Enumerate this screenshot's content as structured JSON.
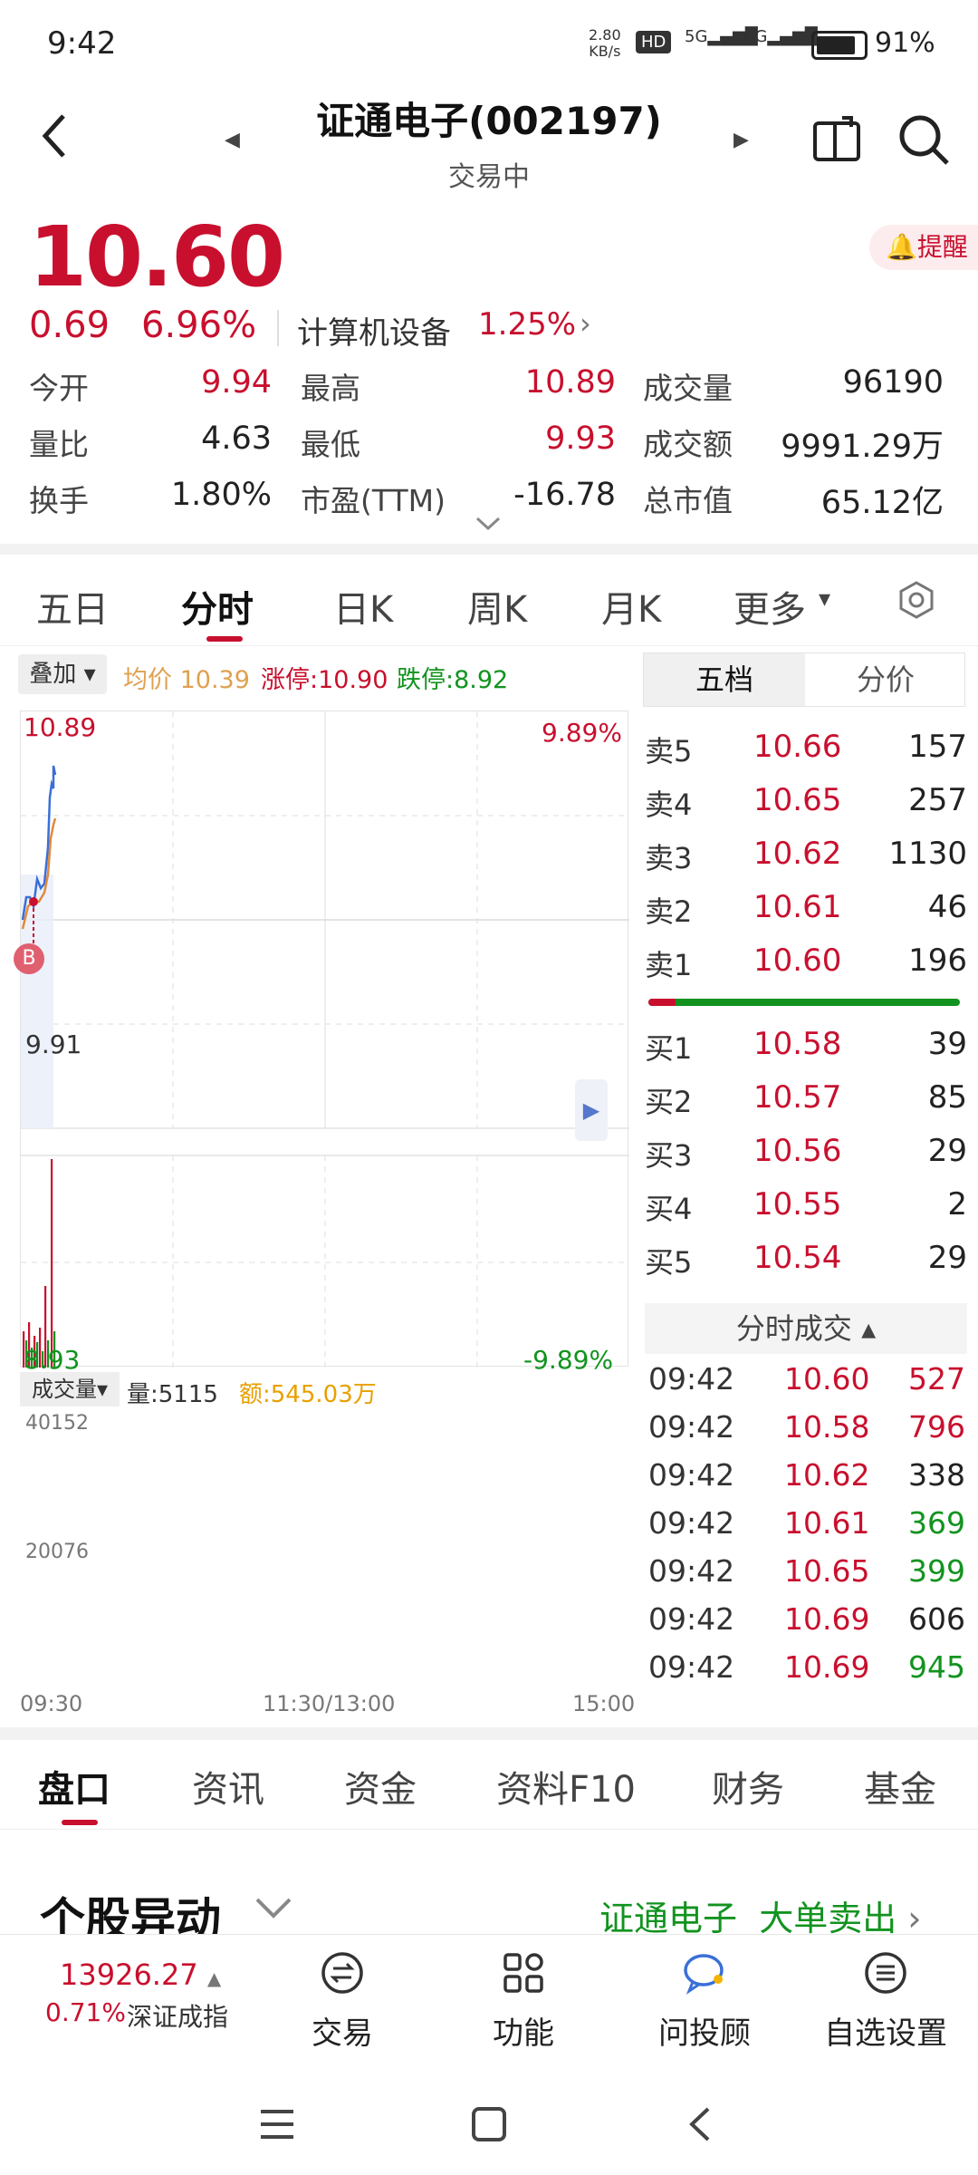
{
  "status_bar": {
    "time": "9:42",
    "net_speed": "2.80",
    "net_unit": "KB/s",
    "hd": "HD",
    "sig1": "5G",
    "sig2": "5G",
    "battery": "91%"
  },
  "header": {
    "title": "证通电子(002197)",
    "subtitle": "交易中"
  },
  "quote": {
    "price": "10.60",
    "change": "0.69",
    "change_pct": "6.96%",
    "sector": "计算机设备",
    "sector_pct": "1.25%",
    "alert_label": "提醒",
    "stats": [
      {
        "label": "今开",
        "value": "9.94",
        "color": "red"
      },
      {
        "label": "最高",
        "value": "10.89",
        "color": "red"
      },
      {
        "label": "成交量",
        "value": "96190",
        "color": "dark"
      },
      {
        "label": "量比",
        "value": "4.63",
        "color": "dark"
      },
      {
        "label": "最低",
        "value": "9.93",
        "color": "red"
      },
      {
        "label": "成交额",
        "value": "9991.29万",
        "color": "dark"
      },
      {
        "label": "换手",
        "value": "1.80%",
        "color": "dark"
      },
      {
        "label": "市盈(TTM)",
        "value": "-16.78",
        "color": "dark"
      },
      {
        "label": "总市值",
        "value": "65.12亿",
        "color": "dark"
      }
    ]
  },
  "chart_tabs": [
    "五日",
    "分时",
    "日K",
    "周K",
    "月K",
    "更多"
  ],
  "chart_tabs_active": "分时",
  "legend": {
    "overlay": "叠加",
    "avg_label": "均价",
    "avg_value": "10.39",
    "limit_up": "涨停:10.90",
    "limit_down": "跌停:8.92"
  },
  "chart_labels": {
    "top_price": "10.89",
    "top_pct": "9.89%",
    "mid_price": "9.91",
    "bottom_price": "8.93",
    "bottom_pct": "-9.89%",
    "buy_marker": "B",
    "vol_btn": "成交量",
    "vol_label": "量:5115",
    "amt_label": "额:545.03万",
    "vol_max": "40152",
    "vol_mid": "20076",
    "time_start": "09:30",
    "time_mid": "11:30/13:00",
    "time_end": "15:00"
  },
  "colors": {
    "up": "#c8102e",
    "down": "#12931f",
    "price_line": "#3a6fd8",
    "avg_line": "#e08a3c"
  },
  "order_book": {
    "tabs": [
      "五档",
      "分价"
    ],
    "asks": [
      {
        "label": "卖5",
        "price": "10.66",
        "qty": "157"
      },
      {
        "label": "卖4",
        "price": "10.65",
        "qty": "257"
      },
      {
        "label": "卖3",
        "price": "10.62",
        "qty": "1130"
      },
      {
        "label": "卖2",
        "price": "10.61",
        "qty": "46"
      },
      {
        "label": "卖1",
        "price": "10.60",
        "qty": "196"
      }
    ],
    "bids": [
      {
        "label": "买1",
        "price": "10.58",
        "qty": "39"
      },
      {
        "label": "买2",
        "price": "10.57",
        "qty": "85"
      },
      {
        "label": "买3",
        "price": "10.56",
        "qty": "29"
      },
      {
        "label": "买4",
        "price": "10.55",
        "qty": "2"
      },
      {
        "label": "买5",
        "price": "10.54",
        "qty": "29"
      }
    ],
    "tick_header": "分时成交",
    "ticks": [
      {
        "time": "09:42",
        "price": "10.60",
        "vol": "527",
        "dir": "up"
      },
      {
        "time": "09:42",
        "price": "10.58",
        "vol": "796",
        "dir": "up"
      },
      {
        "time": "09:42",
        "price": "10.62",
        "vol": "338",
        "dir": "neutral"
      },
      {
        "time": "09:42",
        "price": "10.61",
        "vol": "369",
        "dir": "down"
      },
      {
        "time": "09:42",
        "price": "10.65",
        "vol": "399",
        "dir": "down"
      },
      {
        "time": "09:42",
        "price": "10.69",
        "vol": "606",
        "dir": "neutral"
      },
      {
        "time": "09:42",
        "price": "10.69",
        "vol": "945",
        "dir": "down"
      }
    ]
  },
  "bottom_tabs": [
    "盘口",
    "资讯",
    "资金",
    "资料F10",
    "财务",
    "基金"
  ],
  "bottom_tabs_active": "盘口",
  "anomaly": {
    "title": "个股异动",
    "stock": "证通电子",
    "event": "大单卖出"
  },
  "index": {
    "value": "13926.27",
    "pct": "0.71%",
    "name": "深证成指"
  },
  "bottom_nav": [
    "交易",
    "功能",
    "问投顾",
    "自选设置"
  ]
}
